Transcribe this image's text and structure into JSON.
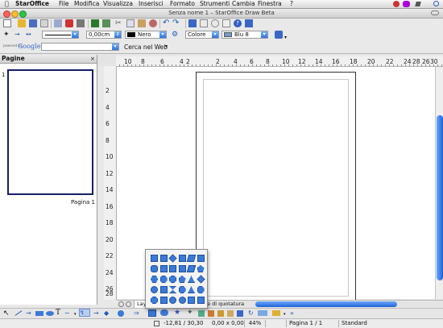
{
  "menubar": {
    "app_name": "StarOffice",
    "items": [
      "File",
      "Modifica",
      "Visualizza",
      "Inserisci",
      "Formato",
      "Strumenti",
      "Cambia",
      "Finestra",
      "?"
    ]
  },
  "window": {
    "title": "Senza nome 1 – StarOffice Draw Beta"
  },
  "line_toolbar": {
    "line_width": "0,00cm",
    "line_color": "Nero",
    "area_style": "Colore",
    "area_color": "Blu 8",
    "line_color_hex": "#000000",
    "area_color_hex": "#729fcf"
  },
  "google_bar": {
    "powered_by": "powered by",
    "brand": "Google",
    "search_value": "",
    "search_web_label": "Cerca nel Web"
  },
  "pages_panel": {
    "title": "Pagine",
    "page_number": "1",
    "page_label": "Pagina 1"
  },
  "rulers": {
    "horizontal": [
      "10",
      "8",
      "6",
      "4",
      "2",
      "2",
      "4",
      "6",
      "8",
      "10",
      "12",
      "14",
      "16",
      "18",
      "20",
      "22",
      "24",
      "26",
      "28",
      "30"
    ],
    "vertical": [
      "2",
      "4",
      "6",
      "8",
      "10",
      "12",
      "14",
      "16",
      "18",
      "20",
      "22",
      "24",
      "26",
      "28"
    ]
  },
  "tabs": {
    "layout": "Layout",
    "dimension_lines": "e di quotatura"
  },
  "statusbar": {
    "coordinates": "-12,81 / 30,30",
    "size": "0,00 x 0,00",
    "zoom": "44%",
    "page": "Pagina 1 / 1",
    "style": "Standard"
  },
  "colors": {
    "selection_blue": "#1f62d6",
    "page_border": "#161e6a"
  }
}
